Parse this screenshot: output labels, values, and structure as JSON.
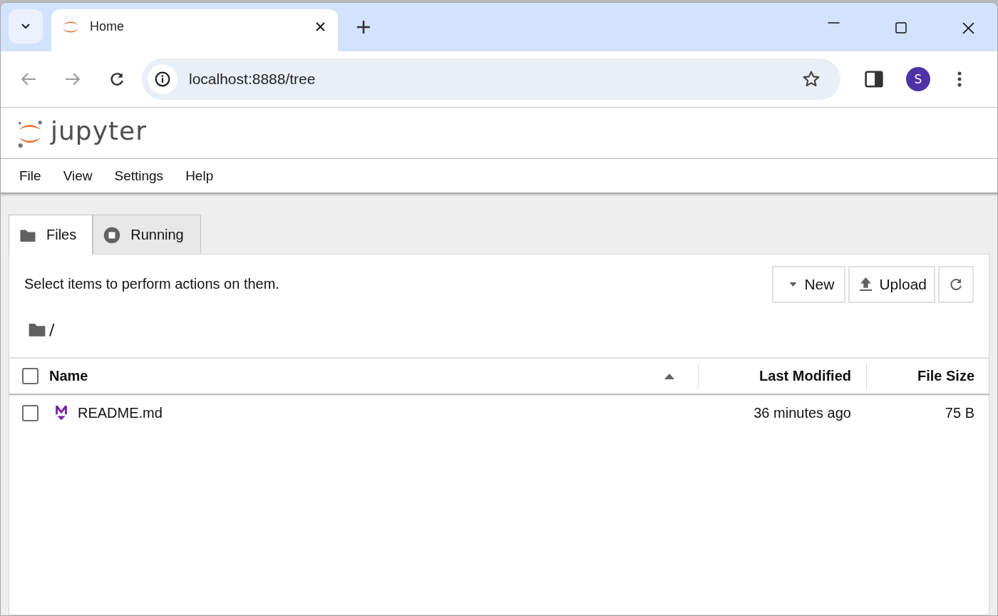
{
  "browser": {
    "tabs": [
      {
        "title": "Home",
        "selected": true
      }
    ],
    "url": "localhost:8888/tree",
    "profile_initial": "S"
  },
  "app": {
    "logo_text": "jupyter",
    "menu": [
      "File",
      "View",
      "Settings",
      "Help"
    ]
  },
  "panel_tabs": [
    {
      "kind": "files",
      "label": "Files",
      "selected": true
    },
    {
      "kind": "running",
      "label": "Running",
      "selected": false
    }
  ],
  "toolbar": {
    "message": "Select items to perform actions on them.",
    "buttons": [
      {
        "kind": "dropdown",
        "label": "New"
      },
      {
        "kind": "upload",
        "label": "Upload"
      },
      {
        "kind": "refresh"
      }
    ]
  },
  "breadcrumb": "/",
  "table": {
    "select_all_checked": false,
    "columns": [
      {
        "label": "Name",
        "sorted": true
      },
      {
        "label": "Last Modified",
        "sorted": false
      },
      {
        "label": "File Size",
        "sorted": false
      }
    ],
    "rows": [
      {
        "kind": "markdown",
        "checked": false,
        "name": "README.md",
        "modified": "36 minutes ago",
        "size": "75 B"
      }
    ]
  }
}
